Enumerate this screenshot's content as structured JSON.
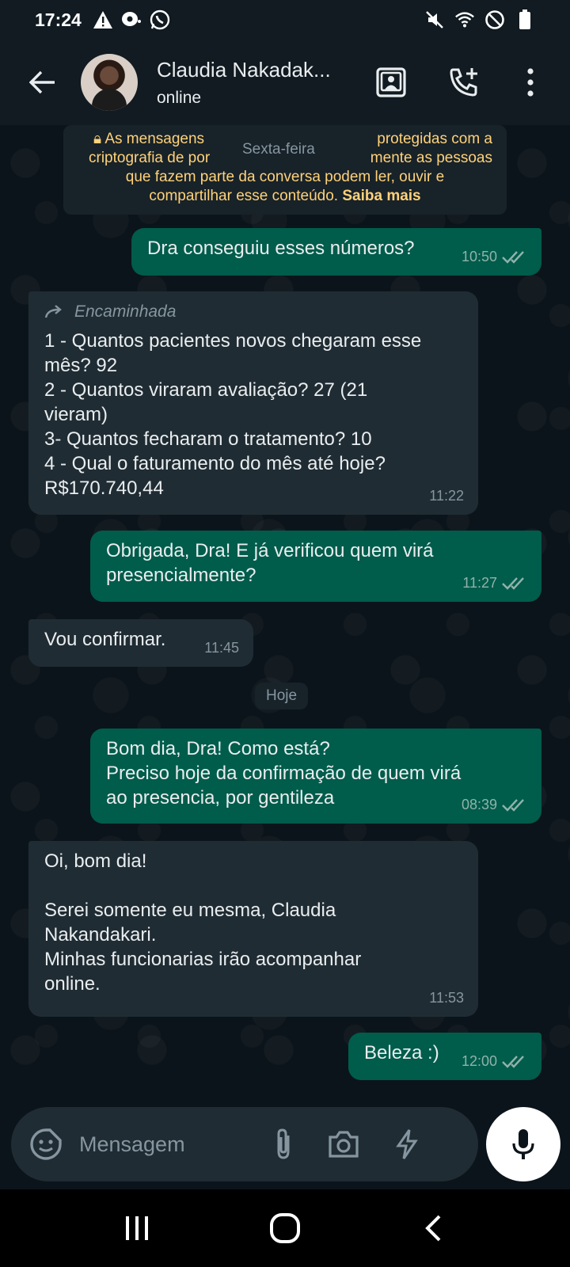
{
  "status_bar": {
    "time": "17:24",
    "left_icons": [
      "warning-icon",
      "messenger-icon",
      "whatsapp-icon"
    ],
    "right_icons": [
      "mute-icon",
      "wifi-icon",
      "do-not-disturb-icon",
      "battery-icon"
    ]
  },
  "header": {
    "contact_name": "Claudia Nakadak...",
    "status": "online",
    "actions": [
      "video-call-icon",
      "add-call-icon",
      "more-vert-icon"
    ]
  },
  "chat": {
    "encryption_notice": {
      "prefix": "As mensagens",
      "line1_end": "protegidas com a",
      "line2_start": "criptografia de por",
      "line2_end": "mente as pessoas",
      "line3": "que fazem parte da conversa podem ler, ouvir e",
      "line4": "compartilhar esse conteúdo.",
      "link": "Saiba mais"
    },
    "day_separator_1": "Sexta-feira",
    "day_separator_2": "Hoje",
    "messages": [
      {
        "direction": "out",
        "text": "Dra conseguiu esses números?",
        "time": "10:50",
        "read": true
      },
      {
        "direction": "in",
        "forwarded_label": "Encaminhada",
        "text": "1 - Quantos pacientes novos chegaram esse\nmês? 92\n2 - Quantos viraram avaliação? 27 (21\nvieram)\n3- Quantos fecharam o tratamento? 10\n4 - Qual o faturamento do mês até hoje?\nR$170.740,44",
        "time": "11:22"
      },
      {
        "direction": "out",
        "text": "Obrigada, Dra! E já verificou quem virá\npresencialmente?",
        "time": "11:27",
        "read": true
      },
      {
        "direction": "in",
        "text": "Vou confirmar.",
        "time": "11:45"
      },
      {
        "direction": "out",
        "text": "Bom dia, Dra! Como está?\nPreciso hoje da confirmação de quem virá\nao presencia, por gentileza",
        "time": "08:39",
        "read": true
      },
      {
        "direction": "in",
        "text": "Oi, bom dia!\n\nSerei somente eu mesma, Claudia\nNakandakari.\nMinhas funcionarias irão acompanhar\nonline.",
        "time": "11:53"
      },
      {
        "direction": "out",
        "text": "Beleza :)",
        "time": "12:00",
        "read": true
      }
    ]
  },
  "input_bar": {
    "placeholder": "Mensagem",
    "buttons": [
      "sticker-icon",
      "attach-icon",
      "camera-icon",
      "quick-reply-icon",
      "mic-icon"
    ]
  },
  "colors": {
    "background": "#0b141a",
    "header": "#111b21",
    "outgoing_bubble": "#005c4b",
    "incoming_bubble": "#202c33",
    "encryption_text": "#ffd279",
    "read_tick": "#8fb3aa"
  }
}
